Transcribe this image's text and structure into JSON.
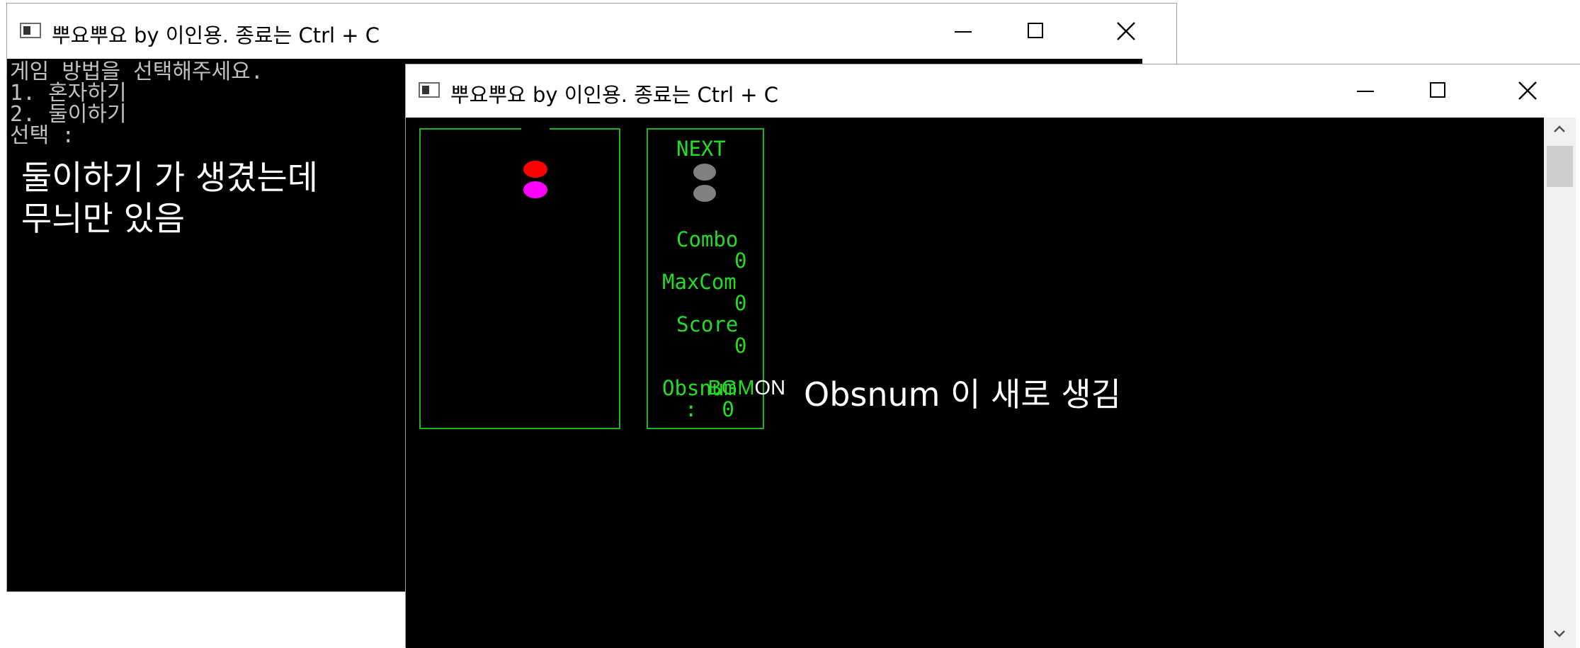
{
  "colors": {
    "console_bg": "#000000",
    "console_text": "#c0c0c0",
    "game_green": "#1db41d",
    "puyo_red": "#ff0000",
    "puyo_magenta": "#ff00ff",
    "puyo_gray": "#808080"
  },
  "icons": [
    "console-app-icon",
    "minimize-icon",
    "maximize-icon",
    "close-icon",
    "scroll-up-icon",
    "scroll-down-icon"
  ],
  "back_window": {
    "title": "뿌요뿌요 by 이인용. 종료는 Ctrl + C",
    "console_lines": [
      "게임 방법을 선택해주세요.",
      "1. 혼자하기",
      "2. 둘이하기",
      "선택 :"
    ],
    "annotation_line1": "둘이하기 가 생겼는데",
    "annotation_line2": "무늬만 있음"
  },
  "front_window": {
    "title": "뿌요뿌요 by 이인용. 종료는 Ctrl + C",
    "board": {
      "falling_pair": [
        "red",
        "magenta"
      ]
    },
    "side_panel": {
      "next_label": "NEXT",
      "next_pair": [
        "gray",
        "gray"
      ],
      "combo_label": "Combo",
      "combo_value": "0",
      "maxcombo_label": "MaxCom",
      "maxcombo_value": "0",
      "score_label": "Score",
      "score_value": "0",
      "bgm_label": "BGM",
      "bgm_value": "ON",
      "obsnum_label": "Obsnum",
      "obsnum_value": ":  0"
    },
    "annotation": "Obsnum 이 새로 생김"
  }
}
